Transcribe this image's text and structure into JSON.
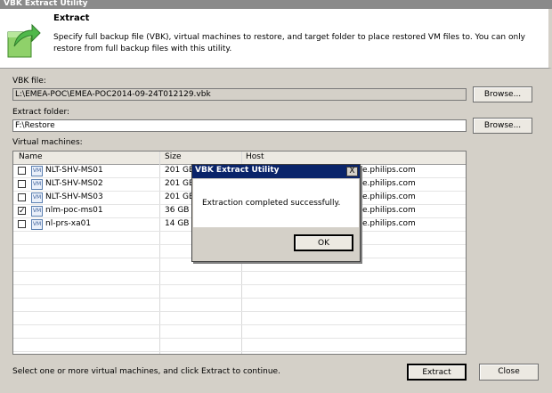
{
  "window": {
    "title": "VBK Extract Utility"
  },
  "header": {
    "title": "Extract",
    "description": "Specify full backup file (VBK), virtual machines to restore, and target folder to place restored VM files to. You can only restore from full backup files with this utility."
  },
  "vbk": {
    "label": "VBK file:",
    "value": "L:\\EMEA-POC\\EMEA-POC2014-09-24T012129.vbk",
    "browse": "Browse..."
  },
  "extract_folder": {
    "label": "Extract folder:",
    "value": "F:\\Restore",
    "browse": "Browse..."
  },
  "vms": {
    "label": "Virtual machines:",
    "columns": [
      "Name",
      "Size",
      "Host"
    ],
    "rows": [
      {
        "checked": false,
        "icon": "vm-icon",
        "name": "NLT-SHV-MS01",
        "size": "201 GB",
        "host": "e.philips.com"
      },
      {
        "checked": false,
        "icon": "vm-icon",
        "name": "NLT-SHV-MS02",
        "size": "201 GB",
        "host": "e.philips.com"
      },
      {
        "checked": false,
        "icon": "vm-icon",
        "name": "NLT-SHV-MS03",
        "size": "201 GB",
        "host": "e.philips.com"
      },
      {
        "checked": true,
        "icon": "vm-icon",
        "name": "nlm-poc-ms01",
        "size": "36 GB",
        "host": "e.philips.com"
      },
      {
        "checked": false,
        "icon": "vm-icon",
        "name": "nl-prs-xa01",
        "size": "14 GB",
        "host": "e.philips.com"
      }
    ]
  },
  "footer": {
    "status": "Select one or more virtual machines, and click Extract to continue.",
    "extract": "Extract",
    "close": "Close"
  },
  "dialog": {
    "title": "VBK Extract Utility",
    "message": "Extraction completed successfully.",
    "ok": "OK",
    "close_glyph": "X"
  },
  "colors": {
    "dialog_title_bg": "#0a246a",
    "window_bg": "#d4d0c8"
  }
}
